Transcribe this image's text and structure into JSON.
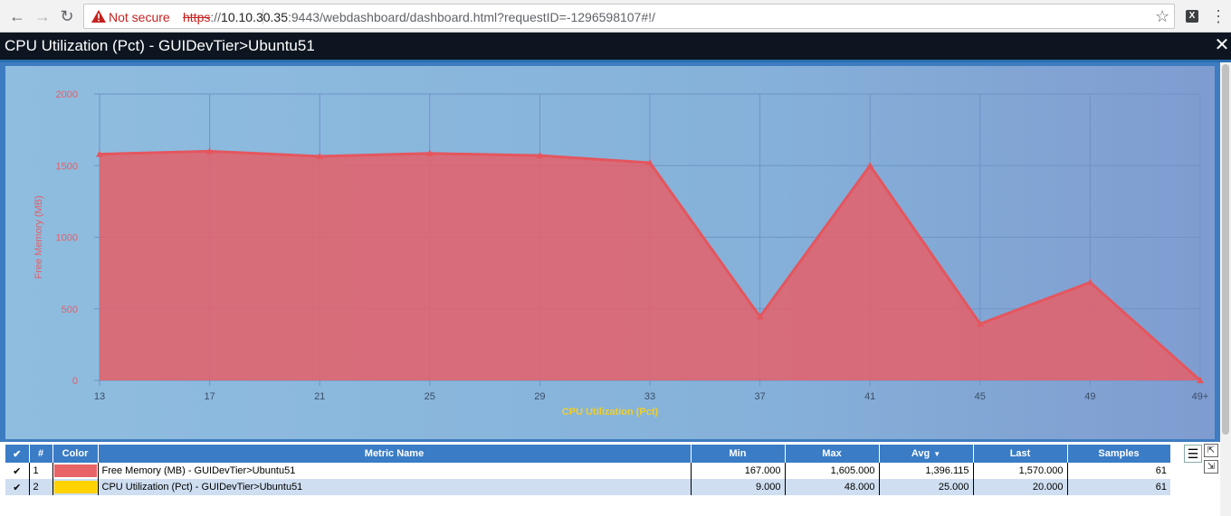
{
  "browser": {
    "not_secure": "Not secure",
    "url_scheme": "https",
    "url_sep": "://",
    "url_host": "10.10.30.35",
    "url_rest": ":9443/webdashboard/dashboard.html?requestID=-1296598107#!/"
  },
  "modal": {
    "title": "CPU Utilization (Pct) - GUIDevTier>Ubuntu51"
  },
  "chart_data": {
    "type": "area",
    "ylabel": "Free Memory (MB)",
    "xlabel": "CPU Utilization (Pct)",
    "x_ticks": [
      "13",
      "17",
      "21",
      "25",
      "29",
      "33",
      "37",
      "41",
      "45",
      "49",
      "49+"
    ],
    "y_ticks": [
      "0",
      "500",
      "1000",
      "1500",
      "2000"
    ],
    "ylim": [
      0,
      2000
    ],
    "grid": true,
    "series": [
      {
        "name": "Free Memory (MB) - GUIDevTier>Ubuntu51",
        "color": "#e2626c",
        "values": [
          1580,
          1600,
          1565,
          1585,
          1570,
          1520,
          445,
          1500,
          395,
          685,
          0
        ]
      }
    ]
  },
  "table": {
    "headers": [
      "#",
      "Color",
      "Metric Name",
      "Min",
      "Max",
      "Avg",
      "Last",
      "Samples"
    ],
    "rows": [
      {
        "index": "1",
        "color": "#e86466",
        "name": "Free Memory (MB) - GUIDevTier>Ubuntu51",
        "min": "167.000",
        "max": "1,605.000",
        "avg": "1,396.115",
        "last": "1,570.000",
        "samples": "61"
      },
      {
        "index": "2",
        "color": "#ffd200",
        "name": "CPU Utilization (Pct) - GUIDevTier>Ubuntu51",
        "min": "9.000",
        "max": "48.000",
        "avg": "25.000",
        "last": "20.000",
        "samples": "61"
      }
    ],
    "check_mark": "✔"
  }
}
